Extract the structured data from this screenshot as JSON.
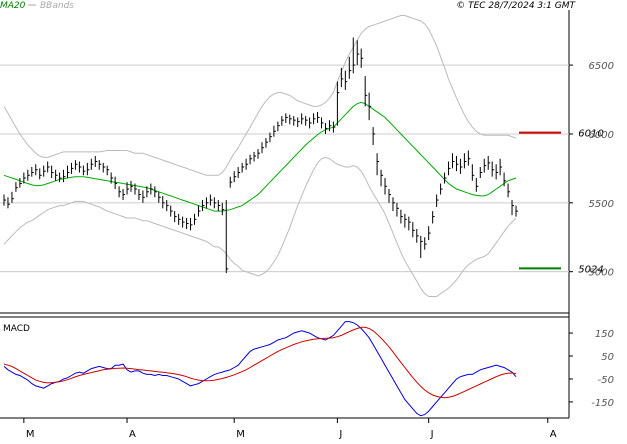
{
  "header": {
    "ma_label": "MA20",
    "bb_label": "BBands",
    "copyright": "© TEC 28/7/2024 3:1 GMT"
  },
  "chart_data": [
    {
      "type": "candlestick",
      "name": "price",
      "ylim": [
        4700,
        6900
      ],
      "yticks": [
        {
          "value": 5000,
          "label": "5000"
        },
        {
          "value": 5500,
          "label": "5500"
        },
        {
          "value": 6000,
          "label": "6000"
        },
        {
          "value": 6500,
          "label": "6500"
        }
      ],
      "x_months": [
        {
          "index": 5,
          "label": "M"
        },
        {
          "index": 31,
          "label": "A"
        },
        {
          "index": 58,
          "label": "M"
        },
        {
          "index": 84,
          "label": "J"
        },
        {
          "index": 107,
          "label": "J"
        },
        {
          "index": 137,
          "label": "A"
        }
      ],
      "n_bars": 130,
      "close": [
        5520,
        5490,
        5530,
        5610,
        5640,
        5680,
        5700,
        5720,
        5740,
        5700,
        5730,
        5760,
        5720,
        5700,
        5680,
        5690,
        5720,
        5750,
        5780,
        5760,
        5730,
        5740,
        5780,
        5800,
        5780,
        5760,
        5740,
        5680,
        5640,
        5580,
        5560,
        5600,
        5620,
        5600,
        5560,
        5540,
        5580,
        5600,
        5580,
        5540,
        5500,
        5480,
        5440,
        5400,
        5380,
        5360,
        5350,
        5340,
        5380,
        5440,
        5480,
        5500,
        5520,
        5500,
        5480,
        5450,
        5020,
        5650,
        5690,
        5720,
        5760,
        5780,
        5820,
        5840,
        5860,
        5900,
        5940,
        5980,
        6020,
        6060,
        6100,
        6120,
        6110,
        6100,
        6090,
        6110,
        6100,
        6080,
        6110,
        6120,
        6080,
        6040,
        6060,
        6050,
        6300,
        6400,
        6380,
        6460,
        6500,
        6580,
        6550,
        6280,
        6200,
        6000,
        5800,
        5700,
        5620,
        5560,
        5500,
        5460,
        5400,
        5380,
        5360,
        5300,
        5260,
        5220,
        5200,
        5280,
        5400,
        5520,
        5600,
        5680,
        5750,
        5800,
        5780,
        5760,
        5800,
        5820,
        5700,
        5620,
        5720,
        5770,
        5790,
        5740,
        5720,
        5760,
        5660,
        5580,
        5480,
        5440
      ],
      "high": [
        5560,
        5540,
        5580,
        5650,
        5680,
        5720,
        5740,
        5760,
        5780,
        5750,
        5770,
        5800,
        5770,
        5740,
        5720,
        5740,
        5770,
        5790,
        5810,
        5800,
        5770,
        5790,
        5820,
        5840,
        5810,
        5790,
        5770,
        5720,
        5690,
        5620,
        5600,
        5650,
        5660,
        5640,
        5600,
        5590,
        5620,
        5640,
        5620,
        5580,
        5550,
        5520,
        5480,
        5440,
        5420,
        5400,
        5390,
        5390,
        5420,
        5480,
        5520,
        5540,
        5560,
        5540,
        5520,
        5500,
        5520,
        5690,
        5730,
        5760,
        5790,
        5820,
        5850,
        5870,
        5890,
        5940,
        5970,
        6010,
        6060,
        6090,
        6130,
        6150,
        6140,
        6130,
        6120,
        6150,
        6130,
        6120,
        6150,
        6160,
        6120,
        6080,
        6100,
        6090,
        6380,
        6480,
        6460,
        6560,
        6700,
        6680,
        6620,
        6420,
        6300,
        6050,
        5860,
        5740,
        5680,
        5600,
        5540,
        5500,
        5450,
        5420,
        5400,
        5360,
        5310,
        5260,
        5250,
        5330,
        5440,
        5560,
        5640,
        5720,
        5800,
        5860,
        5840,
        5820,
        5860,
        5880,
        5780,
        5680,
        5760,
        5820,
        5840,
        5800,
        5780,
        5820,
        5720,
        5640,
        5520,
        5480
      ],
      "low": [
        5480,
        5460,
        5500,
        5580,
        5610,
        5640,
        5660,
        5690,
        5700,
        5670,
        5690,
        5720,
        5680,
        5660,
        5650,
        5650,
        5680,
        5710,
        5740,
        5720,
        5700,
        5700,
        5740,
        5760,
        5740,
        5720,
        5700,
        5640,
        5600,
        5540,
        5520,
        5560,
        5580,
        5560,
        5520,
        5500,
        5540,
        5560,
        5540,
        5500,
        5460,
        5440,
        5400,
        5360,
        5340,
        5320,
        5310,
        5300,
        5340,
        5400,
        5440,
        5460,
        5480,
        5460,
        5440,
        5410,
        4990,
        5610,
        5650,
        5680,
        5720,
        5740,
        5780,
        5800,
        5820,
        5860,
        5900,
        5940,
        5980,
        6020,
        6060,
        6080,
        6070,
        6060,
        6050,
        6070,
        6060,
        6040,
        6070,
        6080,
        6040,
        6000,
        6020,
        6010,
        6060,
        6340,
        6320,
        6400,
        6440,
        6500,
        6480,
        6200,
        6100,
        5920,
        5700,
        5620,
        5560,
        5500,
        5440,
        5400,
        5350,
        5320,
        5300,
        5250,
        5210,
        5100,
        5160,
        5230,
        5350,
        5470,
        5560,
        5640,
        5700,
        5750,
        5730,
        5710,
        5750,
        5770,
        5660,
        5580,
        5680,
        5720,
        5740,
        5690,
        5670,
        5700,
        5620,
        5540,
        5410,
        5400
      ],
      "ma20": [
        5700,
        5690,
        5680,
        5670,
        5660,
        5650,
        5640,
        5630,
        5625,
        5625,
        5630,
        5640,
        5650,
        5660,
        5670,
        5675,
        5680,
        5685,
        5690,
        5690,
        5690,
        5685,
        5680,
        5675,
        5670,
        5665,
        5660,
        5655,
        5650,
        5645,
        5640,
        5635,
        5630,
        5625,
        5620,
        5615,
        5610,
        5600,
        5590,
        5580,
        5570,
        5560,
        5550,
        5540,
        5530,
        5520,
        5510,
        5500,
        5490,
        5480,
        5470,
        5460,
        5450,
        5440,
        5440,
        5440,
        5445,
        5450,
        5460,
        5470,
        5480,
        5500,
        5520,
        5540,
        5560,
        5590,
        5620,
        5650,
        5680,
        5710,
        5740,
        5770,
        5800,
        5830,
        5860,
        5890,
        5920,
        5945,
        5970,
        5995,
        6015,
        6030,
        6040,
        6050,
        6080,
        6110,
        6140,
        6170,
        6200,
        6220,
        6230,
        6220,
        6200,
        6180,
        6160,
        6140,
        6120,
        6090,
        6060,
        6030,
        6000,
        5970,
        5940,
        5910,
        5880,
        5850,
        5820,
        5790,
        5760,
        5730,
        5700,
        5670,
        5640,
        5620,
        5600,
        5590,
        5580,
        5570,
        5560,
        5555,
        5550,
        5550,
        5560,
        5580,
        5600,
        5620,
        5640,
        5660,
        5670,
        5680
      ],
      "bb_upper": [
        6200,
        6150,
        6100,
        6050,
        6000,
        5960,
        5920,
        5890,
        5860,
        5840,
        5830,
        5830,
        5840,
        5850,
        5860,
        5870,
        5870,
        5870,
        5870,
        5870,
        5870,
        5870,
        5870,
        5870,
        5870,
        5875,
        5880,
        5880,
        5880,
        5880,
        5880,
        5880,
        5870,
        5860,
        5860,
        5860,
        5850,
        5840,
        5830,
        5820,
        5810,
        5800,
        5790,
        5780,
        5770,
        5760,
        5750,
        5740,
        5730,
        5720,
        5710,
        5700,
        5700,
        5700,
        5700,
        5720,
        5760,
        5810,
        5860,
        5900,
        5950,
        6000,
        6050,
        6100,
        6150,
        6200,
        6240,
        6270,
        6290,
        6300,
        6300,
        6290,
        6280,
        6260,
        6240,
        6230,
        6220,
        6210,
        6200,
        6200,
        6210,
        6230,
        6260,
        6300,
        6380,
        6450,
        6520,
        6580,
        6630,
        6680,
        6730,
        6760,
        6780,
        6790,
        6800,
        6810,
        6820,
        6830,
        6840,
        6850,
        6860,
        6860,
        6850,
        6840,
        6830,
        6820,
        6800,
        6760,
        6700,
        6640,
        6560,
        6480,
        6400,
        6330,
        6260,
        6200,
        6140,
        6090,
        6050,
        6020,
        6000,
        5990,
        5990,
        5990,
        5990,
        5990,
        5990,
        5990,
        5980,
        5970
      ],
      "bb_lower": [
        5200,
        5230,
        5260,
        5290,
        5320,
        5340,
        5360,
        5370,
        5390,
        5410,
        5430,
        5450,
        5460,
        5470,
        5480,
        5480,
        5490,
        5500,
        5510,
        5510,
        5510,
        5500,
        5490,
        5480,
        5470,
        5455,
        5440,
        5430,
        5420,
        5410,
        5400,
        5390,
        5390,
        5390,
        5380,
        5370,
        5370,
        5360,
        5350,
        5340,
        5330,
        5320,
        5310,
        5300,
        5290,
        5280,
        5270,
        5260,
        5250,
        5240,
        5230,
        5220,
        5200,
        5180,
        5180,
        5160,
        5130,
        5090,
        5060,
        5040,
        5010,
        5000,
        4990,
        4980,
        4970,
        4980,
        5000,
        5030,
        5070,
        5120,
        5180,
        5250,
        5320,
        5400,
        5480,
        5550,
        5620,
        5680,
        5740,
        5790,
        5820,
        5830,
        5820,
        5800,
        5780,
        5770,
        5760,
        5760,
        5770,
        5760,
        5730,
        5680,
        5620,
        5570,
        5520,
        5470,
        5420,
        5350,
        5280,
        5210,
        5140,
        5080,
        5030,
        4980,
        4930,
        4880,
        4840,
        4820,
        4820,
        4820,
        4840,
        4860,
        4880,
        4910,
        4940,
        4980,
        5020,
        5050,
        5070,
        5090,
        5100,
        5110,
        5130,
        5170,
        5210,
        5250,
        5290,
        5330,
        5360,
        5390
      ],
      "levels": [
        {
          "value": 6010,
          "label": "6010",
          "color": "#cc0000"
        },
        {
          "value": 5024,
          "label": "5024",
          "color": "#008000"
        }
      ]
    },
    {
      "type": "line",
      "name": "macd",
      "title": "MACD",
      "ylim": [
        -220,
        220
      ],
      "yticks": [
        {
          "value": 150,
          "label": "150"
        },
        {
          "value": 50,
          "label": "50"
        },
        {
          "value": -50,
          "label": "-50"
        },
        {
          "value": -150,
          "label": "-150"
        }
      ],
      "series": [
        {
          "key": "macd",
          "color": "#0000dd",
          "values": [
            5,
            -10,
            -20,
            -30,
            -35,
            -45,
            -55,
            -70,
            -80,
            -85,
            -90,
            -80,
            -70,
            -65,
            -60,
            -50,
            -45,
            -35,
            -25,
            -20,
            -25,
            -15,
            -5,
            0,
            5,
            0,
            -5,
            -5,
            10,
            10,
            15,
            -10,
            -20,
            -15,
            -15,
            -25,
            -30,
            -30,
            -35,
            -30,
            -35,
            -35,
            -40,
            -45,
            -50,
            -60,
            -70,
            -80,
            -75,
            -70,
            -60,
            -50,
            -40,
            -30,
            -25,
            -20,
            -15,
            -10,
            0,
            10,
            30,
            50,
            70,
            80,
            85,
            90,
            95,
            100,
            110,
            120,
            125,
            130,
            140,
            150,
            155,
            160,
            155,
            150,
            140,
            130,
            125,
            120,
            130,
            140,
            160,
            180,
            200,
            200,
            195,
            185,
            170,
            150,
            130,
            100,
            70,
            40,
            10,
            -20,
            -50,
            -80,
            -110,
            -140,
            -160,
            -180,
            -200,
            -210,
            -205,
            -190,
            -170,
            -150,
            -130,
            -110,
            -90,
            -70,
            -50,
            -40,
            -35,
            -30,
            -30,
            -20,
            -10,
            -5,
            0,
            5,
            10,
            5,
            0,
            -10,
            -20,
            -40
          ]
        },
        {
          "key": "signal",
          "color": "#cc0000",
          "values": [
            15,
            10,
            5,
            -5,
            -15,
            -25,
            -35,
            -45,
            -55,
            -60,
            -65,
            -67,
            -66,
            -64,
            -62,
            -58,
            -53,
            -47,
            -41,
            -35,
            -30,
            -26,
            -22,
            -18,
            -14,
            -10,
            -8,
            -6,
            -4,
            -3,
            -2,
            -3,
            -5,
            -7,
            -9,
            -11,
            -13,
            -15,
            -17,
            -19,
            -21,
            -23,
            -25,
            -28,
            -31,
            -35,
            -40,
            -46,
            -51,
            -55,
            -57,
            -58,
            -57,
            -55,
            -52,
            -48,
            -43,
            -38,
            -32,
            -25,
            -18,
            -10,
            0,
            10,
            20,
            30,
            40,
            50,
            60,
            70,
            78,
            86,
            93,
            100,
            106,
            112,
            116,
            120,
            123,
            125,
            126,
            127,
            128,
            130,
            134,
            140,
            148,
            156,
            164,
            170,
            175,
            175,
            170,
            160,
            145,
            128,
            110,
            90,
            68,
            45,
            22,
            0,
            -22,
            -44,
            -64,
            -82,
            -98,
            -110,
            -120,
            -126,
            -130,
            -132,
            -130,
            -126,
            -120,
            -112,
            -104,
            -96,
            -88,
            -80,
            -72,
            -64,
            -56,
            -48,
            -40,
            -33,
            -28,
            -25,
            -24,
            -26
          ]
        }
      ]
    }
  ]
}
